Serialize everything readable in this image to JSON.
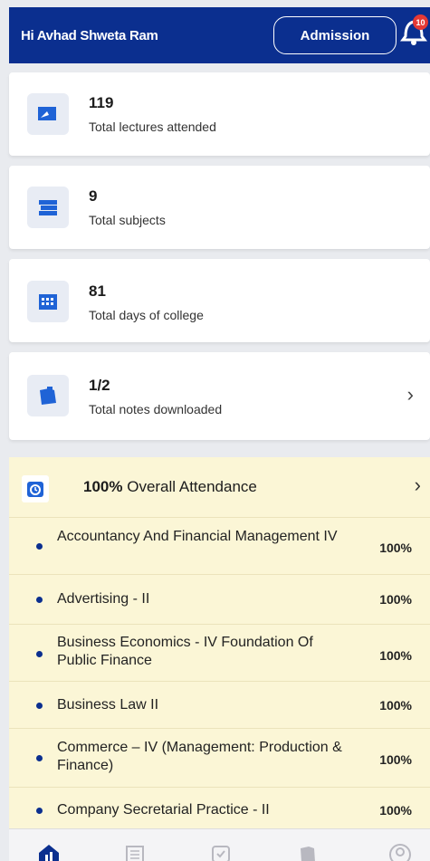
{
  "header": {
    "greeting": "Hi Avhad Shweta Ram",
    "admission_label": "Admission",
    "notification_count": "10"
  },
  "stats": [
    {
      "value": "119",
      "label": "Total lectures attended",
      "icon": "lecture-icon"
    },
    {
      "value": "9",
      "label": "Total subjects",
      "icon": "books-icon"
    },
    {
      "value": "81",
      "label": "Total days of college",
      "icon": "calendar-icon"
    },
    {
      "value": "1/2",
      "label": "Total notes downloaded",
      "icon": "notes-icon"
    }
  ],
  "attendance": {
    "percent": "100%",
    "title": "Overall Attendance",
    "subjects": [
      {
        "name": "Accountancy And Financial Management IV",
        "percent": "100%"
      },
      {
        "name": "Advertising - II",
        "percent": "100%"
      },
      {
        "name": "Business Economics - IV Foundation Of Public Finance",
        "percent": "100%"
      },
      {
        "name": "Business Law II",
        "percent": "100%"
      },
      {
        "name": "Commerce – IV (Management: Production & Finance)",
        "percent": "100%"
      },
      {
        "name": "Company Secretarial Practice - II",
        "percent": "100%"
      }
    ]
  },
  "bottom_nav": [
    "home-icon",
    "timetable-icon",
    "attendance-icon",
    "notes-icon",
    "profile-icon"
  ],
  "colors": {
    "brand": "#0b2f8f",
    "attendance_bg": "#fbf6d6",
    "badge": "#e53935"
  }
}
